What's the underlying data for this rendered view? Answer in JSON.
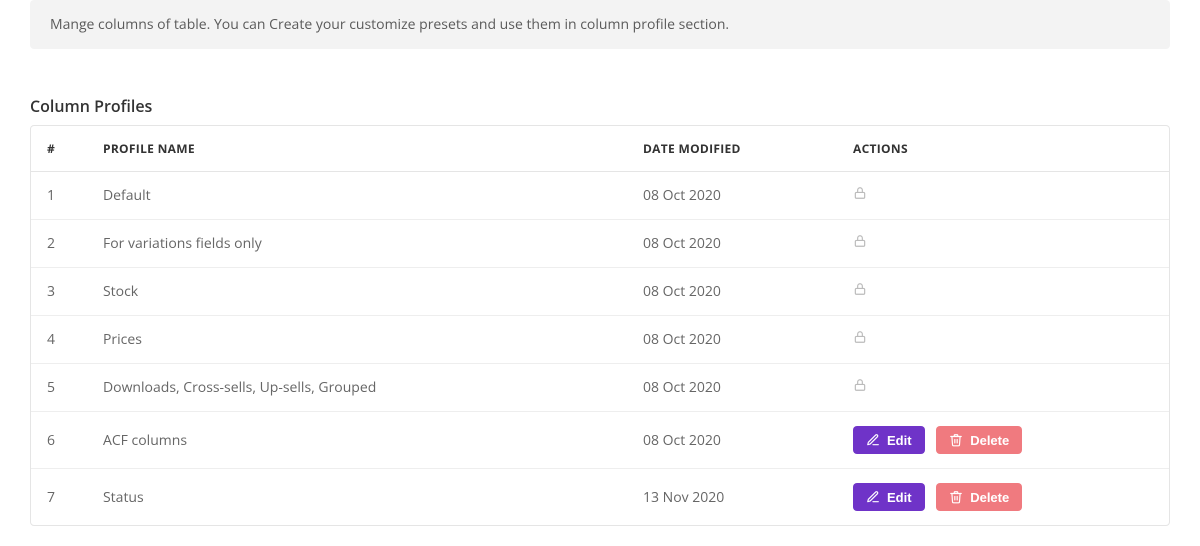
{
  "info_text": "Mange columns of table. You can Create your customize presets and use them in column profile section.",
  "section_title": "Column Profiles",
  "table": {
    "headers": {
      "index": "#",
      "name": "PROFILE NAME",
      "date": "DATE MODIFIED",
      "actions": "ACTIONS"
    },
    "rows": [
      {
        "index": "1",
        "name": "Default",
        "date": "08 Oct 2020",
        "locked": true
      },
      {
        "index": "2",
        "name": "For variations fields only",
        "date": "08 Oct 2020",
        "locked": true
      },
      {
        "index": "3",
        "name": "Stock",
        "date": "08 Oct 2020",
        "locked": true
      },
      {
        "index": "4",
        "name": "Prices",
        "date": "08 Oct 2020",
        "locked": true
      },
      {
        "index": "5",
        "name": "Downloads, Cross-sells, Up-sells, Grouped",
        "date": "08 Oct 2020",
        "locked": true
      },
      {
        "index": "6",
        "name": "ACF columns",
        "date": "08 Oct 2020",
        "locked": false
      },
      {
        "index": "7",
        "name": "Status",
        "date": "13 Nov 2020",
        "locked": false
      }
    ]
  },
  "buttons": {
    "edit": "Edit",
    "delete": "Delete"
  },
  "colors": {
    "edit": "#6f33c8",
    "delete": "#f07a7f",
    "info_bg": "#f3f3f3"
  }
}
